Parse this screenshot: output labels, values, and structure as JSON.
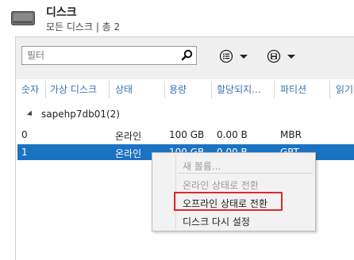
{
  "header": {
    "icon": "disk-drive-icon",
    "title": "디스크",
    "subtitle": "모든 디스크 | 총 2"
  },
  "toolbar": {
    "filter_placeholder": "필터",
    "search_icon": "search-icon",
    "list_view_icon": "list-options-icon",
    "save_icon": "save-query-icon",
    "dropdown_icon": "chevron-down-icon"
  },
  "table": {
    "columns": [
      "숫자",
      "가상 디스크",
      "상태",
      "용량",
      "할당되지...",
      "파티션",
      "읽기"
    ],
    "group": {
      "label": "sapehp7db01(2)"
    },
    "rows": [
      {
        "number": "0",
        "status": "온라인",
        "capacity": "100 GB",
        "allocated": "0.00 B",
        "partition": "MBR",
        "selected": false
      },
      {
        "number": "1",
        "status": "온라인",
        "capacity": "100 GB",
        "allocated": "0.00 B",
        "partition": "GPT",
        "selected": true
      }
    ]
  },
  "context_menu": {
    "items": [
      {
        "label": "새 볼륨...",
        "enabled": false
      },
      {
        "label": "온라인 상태로 전환",
        "enabled": false
      },
      {
        "label": "오프라인 상태로 전환",
        "enabled": true,
        "highlighted": true
      },
      {
        "label": "디스크 다시 설정",
        "enabled": true
      }
    ]
  },
  "colors": {
    "selection": "#1a73c2",
    "column_header": "#3c74b4",
    "highlight_box": "#e0282c"
  }
}
